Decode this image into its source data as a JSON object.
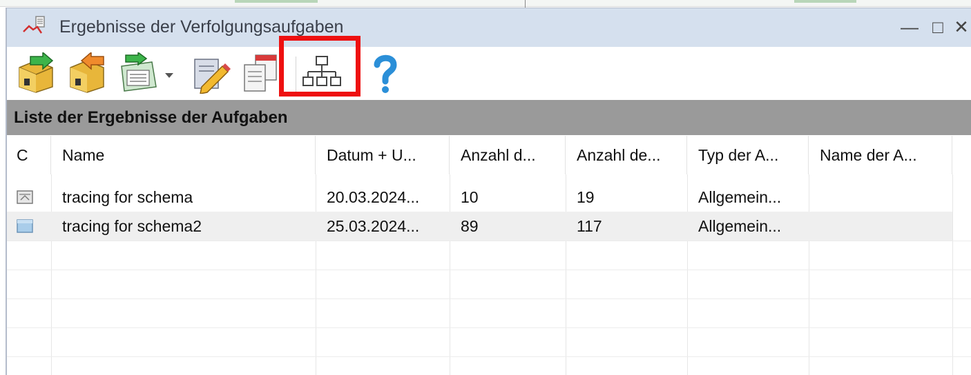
{
  "window": {
    "title": "Ergebnisse der Verfolgungsaufgaben",
    "controls": {
      "minimize": "—",
      "maximize": "□",
      "close": "✕"
    }
  },
  "toolbar": {
    "buttons": [
      {
        "icon": "open-folder-green-arrow-icon"
      },
      {
        "icon": "export-folder-orange-arrow-icon"
      },
      {
        "icon": "report-list-green-arrow-icon"
      },
      {
        "icon": "dropdown-arrow-icon"
      },
      {
        "icon": "edit-pencil-icon"
      },
      {
        "icon": "copy-documents-icon"
      },
      {
        "icon": "hierarchy-tree-icon"
      },
      {
        "icon": "help-question-icon"
      }
    ],
    "highlighted": "hierarchy-tree-icon",
    "highlight_color": "#ee1010"
  },
  "section": {
    "title": "Liste der Ergebnisse der Aufgaben"
  },
  "table": {
    "columns": [
      "C",
      "Name",
      "Datum + U...",
      "Anzahl d...",
      "Anzahl de...",
      "Typ der A...",
      "Name der A..."
    ],
    "rows": [
      {
        "icon": "schema-result-icon",
        "name": "tracing for schema",
        "datum": "20.03.2024...",
        "anzahl1": "10",
        "anzahl2": "19",
        "typ": "Allgemein...",
        "name_a": ""
      },
      {
        "icon": "schema-result-blue-icon",
        "name": "tracing for schema2",
        "datum": "25.03.2024...",
        "anzahl1": "89",
        "anzahl2": "117",
        "typ": "Allgemein...",
        "name_a": ""
      }
    ]
  },
  "colors": {
    "titlebar": "#d5e0ee",
    "section_header": "#9a9a9a",
    "selected_row": "#efefef"
  }
}
